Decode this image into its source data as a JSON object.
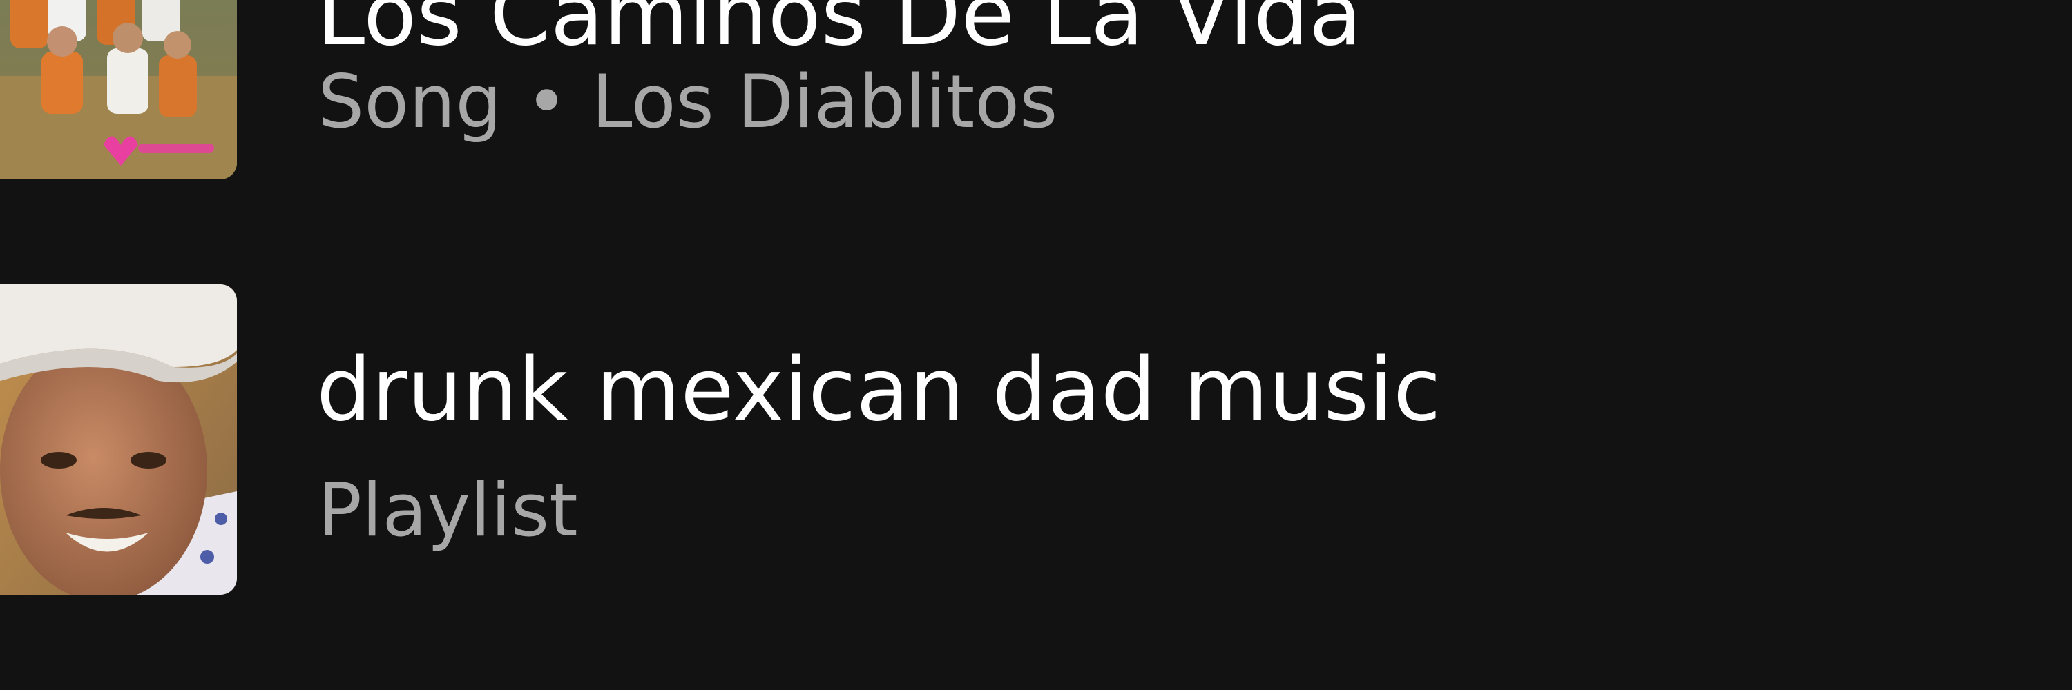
{
  "results": [
    {
      "title": "Los Caminos De La Vida",
      "subtitle": "Song • Los Diablitos",
      "artwork_icon": "album-art-group-photo"
    },
    {
      "title": "drunk mexican dad music",
      "subtitle": "Playlist",
      "artwork_icon": "playlist-art-portrait"
    }
  ],
  "colors": {
    "background": "#121212",
    "title": "#ffffff",
    "subtitle": "#a7a7a7"
  }
}
